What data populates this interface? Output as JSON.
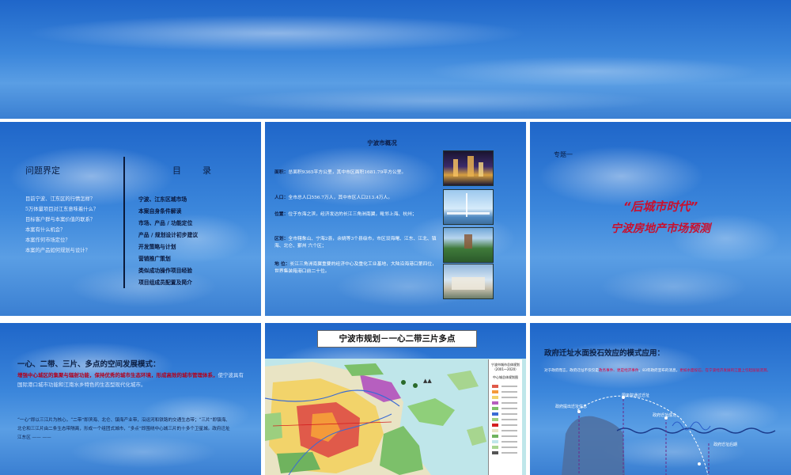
{
  "slide1": {
    "section_title": "问题界定",
    "questions": [
      "目前宁波、江东区的行情怎样？",
      "5万体量项目对江东意味着什么？",
      "目标客户群与本案价值的联系？",
      "本案有什么机会？",
      "本案作何市场定位？",
      "本案的产品如何规划与设计？"
    ],
    "toc_title": "目　录",
    "toc_items": [
      "宁波、江东区城市场",
      "本案自身条件解读",
      "市场、产品 / 功能定位",
      "产品 / 规划设计初步建议",
      "开发策略与计划",
      "营销推广策划",
      "类似成功操作项目经验",
      "项目组成员配置及简介"
    ]
  },
  "slide2": {
    "title": "宁波市概况",
    "items": [
      {
        "label": "面积：",
        "text": "总面积9365平方公里，其中市区面积1681.79平方公里。"
      },
      {
        "label": "人口：",
        "text": "全市总人口556.7万人，其中市区人口213.4万人。"
      },
      {
        "label": "位置：",
        "text": "位于东海之滨，经济发达的长江三角洲南翼，毗邻上海、杭州；"
      },
      {
        "label": "区划：",
        "text": "全市辖象山、宁海2县，余姚等3个县级市，市区设海曙、江东、江北、镇海、北仑、鄞州 六个区；"
      },
      {
        "label": "地 位：",
        "text": "长江三角洲南翼重要的经济中心及重化工业基地，大陆沿海港口第四位，世界集装箱港口前二十位。"
      }
    ]
  },
  "slide3": {
    "tag": "专题一",
    "headline1": "“后城市时代”",
    "headline2": "宁波房地产市场预测"
  },
  "slide4": {
    "title": "一心、二带、三片、多点的空间发展模式：",
    "para1_red": "增强中心城区的集聚与辐射功能，保持优秀的城市生态环境，形成高效的城市管理体系，",
    "para1_light": "使宁波具有国际港口城市功能和江南水乡特色的生态型现代化城市。",
    "para2": "“一心”即以三江片为核心，“二带”即滨海、北仑、镇海产业带，沿运河和铁路的交通生态带；“三片”即镇海、北仑和三江片由二条生态带隔离，形成一个组团式城市，“多点”即围绕中心城三片的十多个卫星城。政府迁址江东区 —— ——"
  },
  "slide5": {
    "title": "宁波市规划－一心二带三片多点",
    "legend_title": "宁波市城市总体规划（2001～2020）",
    "legend_sub": "中心城总体规划图"
  },
  "slide6": {
    "title": "政府迁址水面投石效应的模式应用：",
    "para_white": "对于政府而言，政府迁址不仅仅是",
    "para_red1": "政务事件、更是经济事件",
    "para_white2": "。83年政府宣布的消息，",
    "para_red2": "更如水面投石，在宁波经济发展的江面上引起层层涟漪。",
    "labels": {
      "approved": "国务院通过迁址",
      "announce": "政府提出迁址信息",
      "success": "政府迁址成功",
      "after": "政府迁址后期"
    }
  },
  "colors": {
    "sky_top": "#1f66c9",
    "headline_red": "#c8102e",
    "dark_text": "#0b1f44"
  }
}
